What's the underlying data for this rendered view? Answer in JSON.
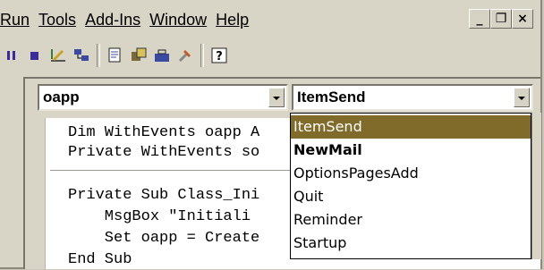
{
  "menubar": {
    "items": [
      {
        "label": "Run"
      },
      {
        "label": "Tools"
      },
      {
        "label": "Add-Ins"
      },
      {
        "label": "Window"
      },
      {
        "label": "Help"
      }
    ]
  },
  "window_controls": {
    "minimize": "_",
    "restore": "❐",
    "close": "×"
  },
  "toolbar": {
    "icons": [
      "pause-icon",
      "stop-icon",
      "design-mode-icon",
      "project-explorer-icon",
      "properties-icon",
      "object-browser-icon",
      "toolbox-icon",
      "help-icon"
    ]
  },
  "combos": {
    "object": {
      "value": "oapp"
    },
    "procedure": {
      "value": "ItemSend"
    }
  },
  "code": {
    "lines": [
      "Dim WithEvents oapp A",
      "Private WithEvents so",
      "Private Sub Class_Ini",
      "    MsgBox \"Initiali",
      "    Set oapp = Create",
      "End Sub"
    ]
  },
  "dropdown": {
    "items": [
      {
        "label": "ItemSend",
        "selected": true,
        "bold": false
      },
      {
        "label": "NewMail",
        "selected": false,
        "bold": true
      },
      {
        "label": "OptionsPagesAdd",
        "selected": false,
        "bold": false
      },
      {
        "label": "Quit",
        "selected": false,
        "bold": false
      },
      {
        "label": "Reminder",
        "selected": false,
        "bold": false
      },
      {
        "label": "Startup",
        "selected": false,
        "bold": false
      }
    ]
  },
  "colors": {
    "selection": "#816b2a",
    "chrome": "#d8d4c6"
  }
}
